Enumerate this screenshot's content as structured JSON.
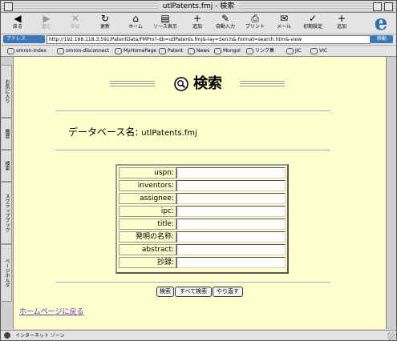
{
  "window": {
    "title": "utlPatents.fmj - 検索"
  },
  "toolbar": {
    "buttons": [
      {
        "label": "戻る",
        "icon": "◀"
      },
      {
        "label": "進む",
        "icon": "▶"
      },
      {
        "label": "中止",
        "icon": "✕"
      },
      {
        "label": "更新",
        "icon": "↻"
      },
      {
        "label": "ホーム",
        "icon": "⌂"
      },
      {
        "label": "ソース表示",
        "icon": "▤"
      },
      {
        "label": "追加",
        "icon": "+"
      },
      {
        "label": "自動入力",
        "icon": "✎"
      },
      {
        "label": "プリント",
        "icon": "⎙"
      },
      {
        "label": "メール",
        "icon": "✉"
      },
      {
        "label": "初期設定",
        "icon": "✓"
      },
      {
        "label": "追加",
        "icon": "+"
      }
    ]
  },
  "address": {
    "label": "アドレス",
    "url": "http://192.168.118.3:591/PatentData/FMPro?-db=utlPatents.fmj&-lay=Serch&-format=search.htm&-view",
    "go_label": "移動"
  },
  "links": [
    "omron-index",
    "omron-disconnect",
    "MyHomePage",
    "Patent",
    "News",
    "Mongol",
    "リンク集",
    "JIC",
    "VIC"
  ],
  "sidetabs": [
    "お気に入り",
    "履歴",
    "検索",
    "スクラップブック",
    "ページホルダ"
  ],
  "page": {
    "heading": "検索",
    "db_label": "データベース名:",
    "db_name": "utlPatents.fmj",
    "fields": [
      "uspn:",
      "inventors:",
      "assignee:",
      "ipc:",
      "title:",
      "発明の名称:",
      "abstract:",
      "抄録:"
    ],
    "buttons": {
      "search": "検索",
      "search_all": "すべて検索",
      "reset": "やり直す"
    },
    "home_link": "ホームページに戻る"
  },
  "status": {
    "text": "インターネット ゾーン"
  },
  "colors": {
    "content_bg": "#ffffcc",
    "accent": "#3a78b8",
    "link": "#6633cc"
  }
}
